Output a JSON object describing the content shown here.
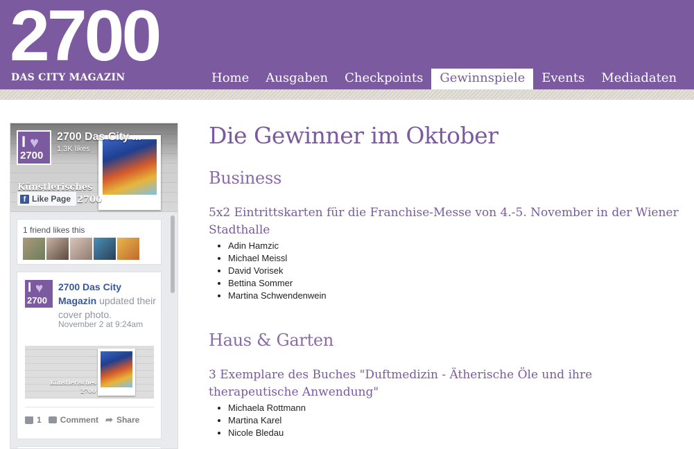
{
  "header": {
    "logo_number": "2700",
    "logo_subtitle": "DAS CITY MAGAZIN",
    "nav": [
      {
        "label": "Home",
        "active": false
      },
      {
        "label": "Ausgaben",
        "active": false
      },
      {
        "label": "Checkpoints",
        "active": false
      },
      {
        "label": "Gewinnspiele",
        "active": true
      },
      {
        "label": "Events",
        "active": false
      },
      {
        "label": "Mediadaten",
        "active": false
      }
    ],
    "accent_color": "#7b5a9f"
  },
  "fb_widget": {
    "page_name": "2700 Das City ...",
    "likes": "1.3K likes",
    "cover_text_1": "Künstlerisches",
    "cover_text_2": "2700",
    "like_button": "Like Page",
    "friends_label": "1 friend likes this",
    "logo_i": "I",
    "logo_num": "2700",
    "post": {
      "author": "2700 Das City Magazin",
      "action": "updated their cover photo.",
      "time": "November 2 at 9:24am",
      "photo_text_1": "Künstlerisches",
      "photo_text_2": "2700",
      "like_count": "1",
      "comment_label": "Comment",
      "share_label": "Share"
    }
  },
  "content": {
    "title": "Die Gewinner im Oktober",
    "sections": [
      {
        "heading": "Business",
        "prize": "5x2 Eintrittskarten für die Franchise-Messe von 4.-5. November in der Wiener Stadthalle",
        "winners": [
          "Adin Hamzic",
          "Michael Meissl",
          "David Vorisek",
          "Bettina Sommer",
          "Martina Schwendenwein"
        ]
      },
      {
        "heading": "Haus & Garten",
        "prize": "3 Exemplare des Buches \"Duftmedizin - Ätherische Öle und ihre therapeutische Anwendung\"",
        "winners": [
          "Michaela Rottmann",
          "Martina Karel",
          "Nicole Bledau"
        ]
      }
    ]
  }
}
